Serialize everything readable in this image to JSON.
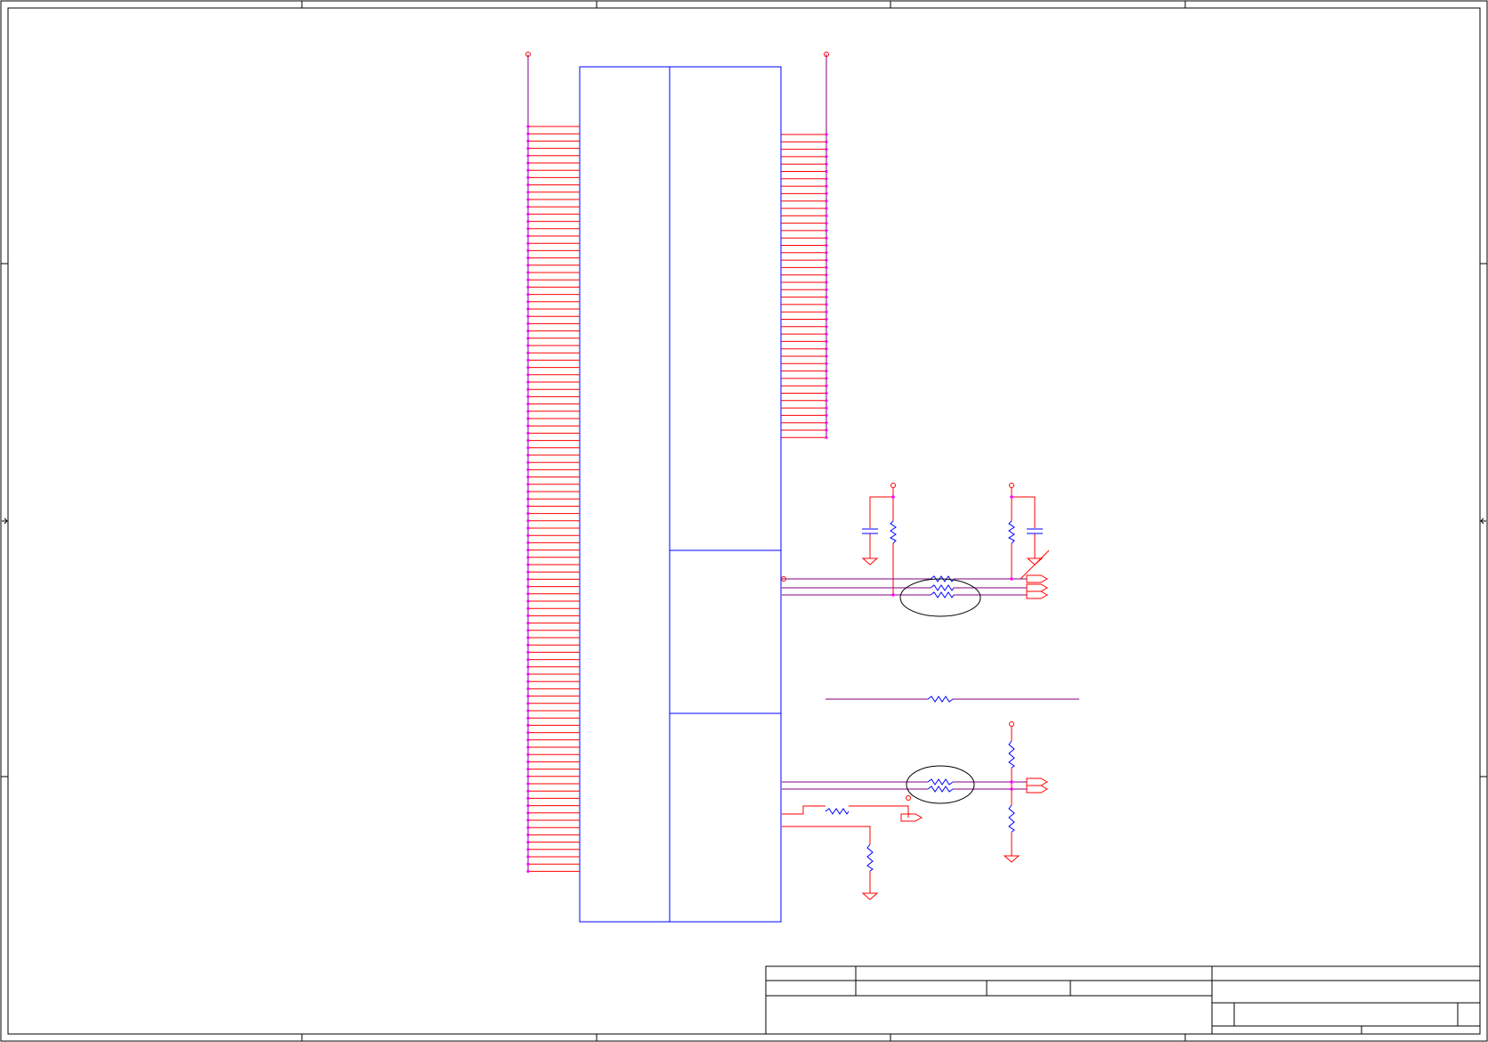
{
  "sheet": {
    "title": "",
    "document_number": "",
    "revision": "",
    "size": "",
    "date": "",
    "sheet_of": ""
  },
  "colors": {
    "border": "#000000",
    "component": "#0000ff",
    "wire": "#ff0000",
    "bus": "#800080",
    "junction": "#ff00ff",
    "background": "#ffffff"
  },
  "connector": {
    "left_pin_count": 103,
    "right_pin_count": 42,
    "sections": 3
  },
  "icons": {
    "power_port": "power-port-icon",
    "ground": "ground-icon",
    "resistor": "resistor-icon",
    "capacitor": "capacitor-icon",
    "ferrite_bead": "ferrite-bead-icon",
    "off_page_connector": "off-page-connector-icon"
  }
}
